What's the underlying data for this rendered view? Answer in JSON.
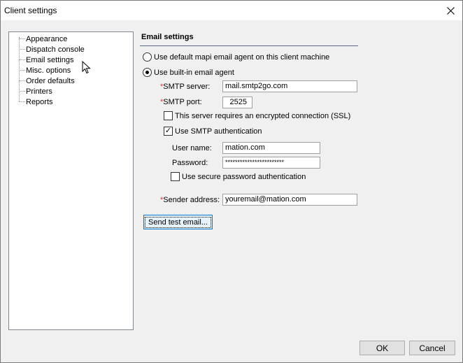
{
  "window": {
    "title": "Client settings"
  },
  "tree": {
    "items": [
      {
        "label": "Appearance"
      },
      {
        "label": "Dispatch console"
      },
      {
        "label": "Email settings"
      },
      {
        "label": "Misc. options"
      },
      {
        "label": "Order defaults"
      },
      {
        "label": "Printers"
      },
      {
        "label": "Reports"
      }
    ]
  },
  "email": {
    "section_title": "Email settings",
    "radio_mapi_label": "Use default mapi email agent on this client machine",
    "radio_mapi_selected": false,
    "radio_builtin_label": "Use built-in email agent",
    "radio_builtin_selected": true,
    "required_mark": "*",
    "smtp_server_label": "SMTP server:",
    "smtp_server_value": "mail.smtp2go.com",
    "smtp_port_label": "SMTP port:",
    "smtp_port_value": "2525",
    "ssl_label": "This server requires an encrypted connection (SSL)",
    "ssl_checked": false,
    "auth_label": "Use SMTP authentication",
    "auth_checked": true,
    "check_mark": "✓",
    "username_label": "User name:",
    "username_value": "mation.com",
    "password_label": "Password:",
    "password_value": "************************",
    "spa_label": "Use secure password authentication",
    "spa_checked": false,
    "sender_label": "Sender address:",
    "sender_value": "youremail@mation.com",
    "send_test_label": "Send test email..."
  },
  "footer": {
    "ok_label": "OK",
    "cancel_label": "Cancel"
  },
  "icons": {
    "close": "close-icon",
    "cursor": "mouse-pointer-icon"
  }
}
